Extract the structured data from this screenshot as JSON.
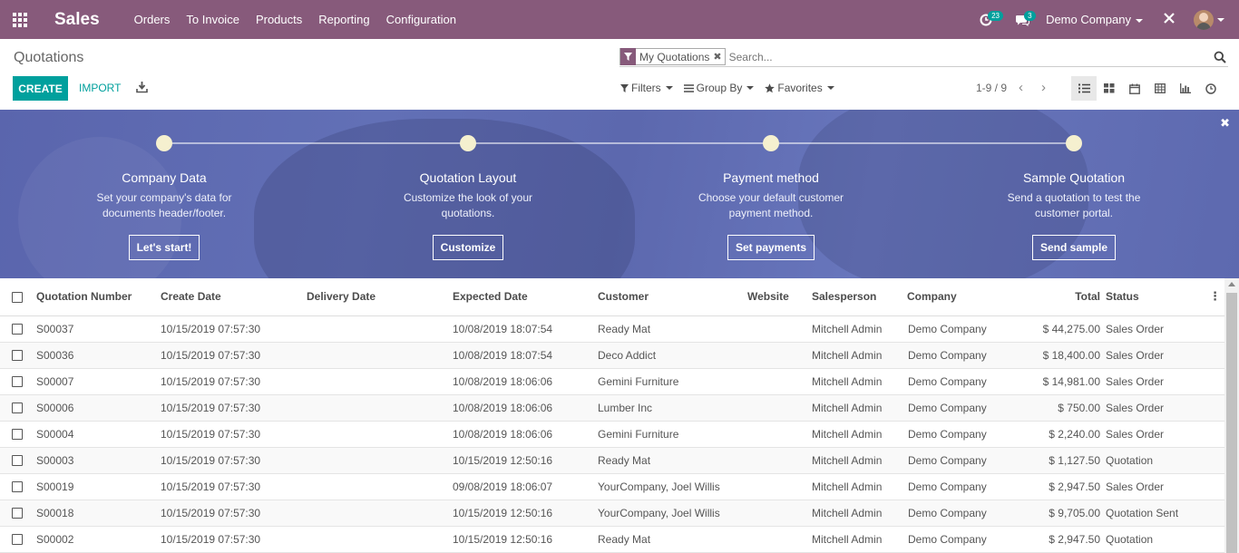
{
  "navbar": {
    "app_name": "Sales",
    "menu": [
      "Orders",
      "To Invoice",
      "Products",
      "Reporting",
      "Configuration"
    ],
    "activity_count": "23",
    "messages_count": "3",
    "company": "Demo Company",
    "icons": [
      "apps-grid-icon",
      "activity-clock-icon",
      "chat-icon",
      "debug-tools-icon",
      "user-avatar"
    ]
  },
  "control_panel": {
    "breadcrumb": "Quotations",
    "search": {
      "facet_label": "My Quotations",
      "placeholder": "Search..."
    },
    "create_label": "CREATE",
    "import_label": "IMPORT",
    "filters_label": "Filters",
    "groupby_label": "Group By",
    "favorites_label": "Favorites",
    "pager": "1-9 / 9",
    "views": [
      "list-view",
      "kanban-view",
      "calendar-view",
      "pivot-view",
      "graph-view",
      "activity-view"
    ]
  },
  "onboarding": {
    "steps": [
      {
        "title": "Company Data",
        "desc": "Set your company's data for documents header/footer.",
        "button": "Let's start!"
      },
      {
        "title": "Quotation Layout",
        "desc": "Customize the look of your quotations.",
        "button": "Customize"
      },
      {
        "title": "Payment method",
        "desc": "Choose your default customer payment method.",
        "button": "Set payments"
      },
      {
        "title": "Sample Quotation",
        "desc": "Send a quotation to test the customer portal.",
        "button": "Send sample"
      }
    ]
  },
  "table": {
    "columns": [
      "Quotation Number",
      "Create Date",
      "Delivery Date",
      "Expected Date",
      "Customer",
      "Website",
      "Salesperson",
      "Company",
      "Total",
      "Status"
    ],
    "rows": [
      {
        "number": "S00037",
        "create": "10/15/2019 07:57:30",
        "delivery": "",
        "expected": "10/08/2019 18:07:54",
        "customer": "Ready Mat",
        "website": "",
        "salesperson": "Mitchell Admin",
        "company": "Demo Company",
        "total": "$ 44,275.00",
        "status": "Sales Order"
      },
      {
        "number": "S00036",
        "create": "10/15/2019 07:57:30",
        "delivery": "",
        "expected": "10/08/2019 18:07:54",
        "customer": "Deco Addict",
        "website": "",
        "salesperson": "Mitchell Admin",
        "company": "Demo Company",
        "total": "$ 18,400.00",
        "status": "Sales Order"
      },
      {
        "number": "S00007",
        "create": "10/15/2019 07:57:30",
        "delivery": "",
        "expected": "10/08/2019 18:06:06",
        "customer": "Gemini Furniture",
        "website": "",
        "salesperson": "Mitchell Admin",
        "company": "Demo Company",
        "total": "$ 14,981.00",
        "status": "Sales Order"
      },
      {
        "number": "S00006",
        "create": "10/15/2019 07:57:30",
        "delivery": "",
        "expected": "10/08/2019 18:06:06",
        "customer": "Lumber Inc",
        "website": "",
        "salesperson": "Mitchell Admin",
        "company": "Demo Company",
        "total": "$ 750.00",
        "status": "Sales Order"
      },
      {
        "number": "S00004",
        "create": "10/15/2019 07:57:30",
        "delivery": "",
        "expected": "10/08/2019 18:06:06",
        "customer": "Gemini Furniture",
        "website": "",
        "salesperson": "Mitchell Admin",
        "company": "Demo Company",
        "total": "$ 2,240.00",
        "status": "Sales Order"
      },
      {
        "number": "S00003",
        "create": "10/15/2019 07:57:30",
        "delivery": "",
        "expected": "10/15/2019 12:50:16",
        "customer": "Ready Mat",
        "website": "",
        "salesperson": "Mitchell Admin",
        "company": "Demo Company",
        "total": "$ 1,127.50",
        "status": "Quotation"
      },
      {
        "number": "S00019",
        "create": "10/15/2019 07:57:30",
        "delivery": "",
        "expected": "09/08/2019 18:06:07",
        "customer": "YourCompany, Joel Willis",
        "website": "",
        "salesperson": "Mitchell Admin",
        "company": "Demo Company",
        "total": "$ 2,947.50",
        "status": "Sales Order"
      },
      {
        "number": "S00018",
        "create": "10/15/2019 07:57:30",
        "delivery": "",
        "expected": "10/15/2019 12:50:16",
        "customer": "YourCompany, Joel Willis",
        "website": "",
        "salesperson": "Mitchell Admin",
        "company": "Demo Company",
        "total": "$ 9,705.00",
        "status": "Quotation Sent"
      },
      {
        "number": "S00002",
        "create": "10/15/2019 07:57:30",
        "delivery": "",
        "expected": "10/15/2019 12:50:16",
        "customer": "Ready Mat",
        "website": "",
        "salesperson": "Mitchell Admin",
        "company": "Demo Company",
        "total": "$ 2,947.50",
        "status": "Quotation"
      }
    ]
  },
  "colors": {
    "navbar": "#875A7B",
    "accent": "#00A09D",
    "banner": "#6270b6"
  }
}
